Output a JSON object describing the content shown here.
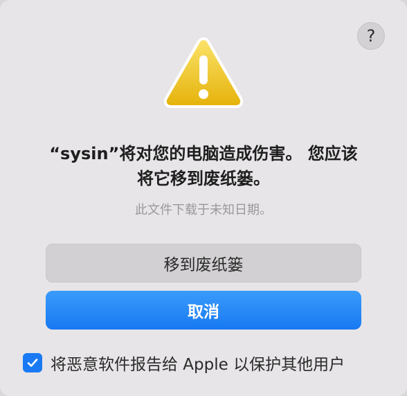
{
  "dialog": {
    "help_label": "?",
    "title_line1": "“sysin”将对您的电脑造成伤害。 您应该",
    "title_line2": "将它移到废纸篓。",
    "subtitle": "此文件下载于未知日期。",
    "move_to_trash_label": "移到废纸篓",
    "cancel_label": "取消",
    "report_label": "将恶意软件报告给 Apple 以保护其他用户",
    "report_checked": true
  },
  "icons": {
    "warning": "warning-triangle-icon",
    "checkbox": "checkmark-icon"
  },
  "colors": {
    "accent": "#1a7af3",
    "warning_yellow": "#f4cc1e",
    "dialog_bg": "#e7e5e7"
  }
}
